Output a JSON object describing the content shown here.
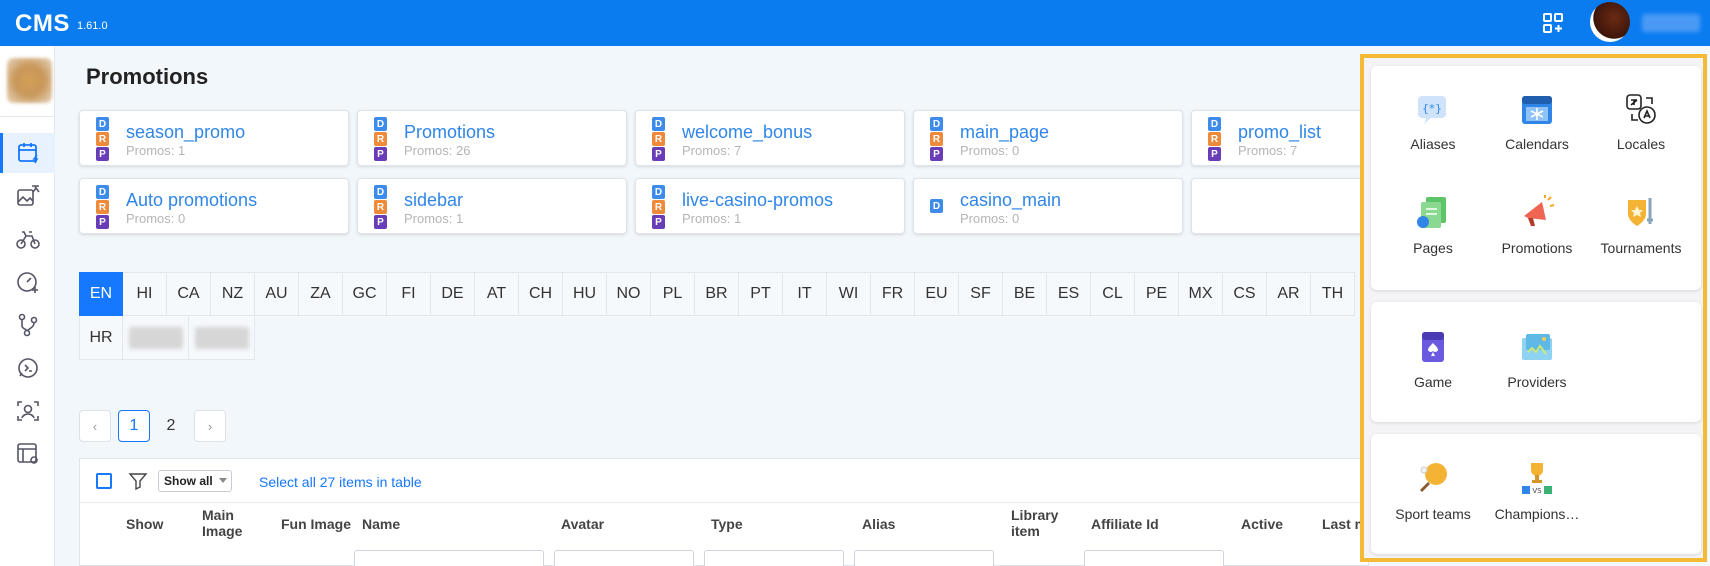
{
  "header": {
    "brand": "CMS",
    "version": "1.61.0"
  },
  "sidebar": {
    "items": [
      {
        "icon": "calendar-bolt-icon",
        "active": true
      },
      {
        "icon": "image-translate-icon",
        "active": false
      },
      {
        "icon": "bicycle-icon",
        "active": false
      },
      {
        "icon": "gauge-plus-icon",
        "active": false
      },
      {
        "icon": "route-icon",
        "active": false
      },
      {
        "icon": "chat-code-icon",
        "active": false
      },
      {
        "icon": "user-scan-icon",
        "active": false
      },
      {
        "icon": "layout-settings-icon",
        "active": false
      }
    ]
  },
  "page": {
    "title": "Promotions"
  },
  "cards": [
    {
      "name": "season_promo",
      "sub": "Promos: 1",
      "badges": [
        "D",
        "R",
        "P"
      ]
    },
    {
      "name": "Promotions",
      "sub": "Promos: 26",
      "badges": [
        "D",
        "R",
        "P"
      ]
    },
    {
      "name": "welcome_bonus",
      "sub": "Promos: 7",
      "badges": [
        "D",
        "R",
        "P"
      ]
    },
    {
      "name": "main_page",
      "sub": "Promos: 0",
      "badges": [
        "D",
        "R",
        "P"
      ]
    },
    {
      "name": "promo_list",
      "sub": "Promos: 7",
      "badges": [
        "D",
        "R",
        "P"
      ]
    },
    {
      "name": "Auto promotions",
      "sub": "Promos: 0",
      "badges": [
        "D",
        "R",
        "P"
      ]
    },
    {
      "name": "sidebar",
      "sub": "Promos: 1",
      "badges": [
        "D",
        "R",
        "P"
      ]
    },
    {
      "name": "live-casino-promos",
      "sub": "Promos: 1",
      "badges": [
        "D",
        "R",
        "P"
      ]
    },
    {
      "name": "casino_main",
      "sub": "Promos: 0",
      "badges": [
        "D"
      ]
    }
  ],
  "languages": [
    "EN",
    "HI",
    "CA",
    "NZ",
    "AU",
    "ZA",
    "GC",
    "FI",
    "DE",
    "AT",
    "CH",
    "HU",
    "NO",
    "PL",
    "BR",
    "PT",
    "IT",
    "WI",
    "FR",
    "EU",
    "SF",
    "BE",
    "ES",
    "CL",
    "PE",
    "MX",
    "CS",
    "AR",
    "TH"
  ],
  "languages_row2": [
    "HR"
  ],
  "pagination": {
    "prev": "‹",
    "next": "›",
    "pages": [
      "1",
      "2"
    ],
    "current": "1"
  },
  "table": {
    "show_select": "Show all",
    "select_all": "Select all 27 items in table",
    "columns": [
      "Show",
      "Main Image",
      "Fun Image",
      "Name",
      "Avatar",
      "Type",
      "Alias",
      "Library item",
      "Affiliate Id",
      "Active",
      "Last m"
    ]
  },
  "apps_panel": {
    "groups": [
      [
        {
          "label": "Aliases",
          "icon": "aliases-icon"
        },
        {
          "label": "Calendars",
          "icon": "calendar-icon"
        },
        {
          "label": "Locales",
          "icon": "translate-icon"
        },
        {
          "label": "Pages",
          "icon": "pages-icon"
        },
        {
          "label": "Promotions",
          "icon": "megaphone-icon"
        },
        {
          "label": "Tournaments",
          "icon": "tournament-shield-icon"
        }
      ],
      [
        {
          "label": "Game",
          "icon": "game-card-icon"
        },
        {
          "label": "Providers",
          "icon": "providers-icon"
        }
      ],
      [
        {
          "label": "Sport teams",
          "icon": "ping-pong-icon"
        },
        {
          "label": "Champions…",
          "icon": "trophy-icon"
        }
      ]
    ]
  }
}
